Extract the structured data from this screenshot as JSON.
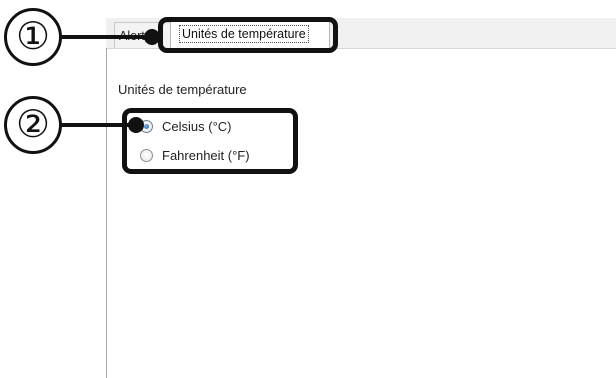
{
  "tabs": [
    {
      "label": "Alertes",
      "selected": false
    },
    {
      "label": "Unités de température",
      "selected": true
    }
  ],
  "group": {
    "title": "Unités de température",
    "options": [
      {
        "label": "Celsius (°C)",
        "checked": true
      },
      {
        "label": "Fahrenheit (°F)",
        "checked": false
      }
    ]
  },
  "annotations": {
    "callout_1": "①",
    "callout_2": "②"
  },
  "colors": {
    "annotation": "#111111",
    "radio_selected": "#1d5fb0",
    "tabstrip": "#f0f0f0"
  }
}
